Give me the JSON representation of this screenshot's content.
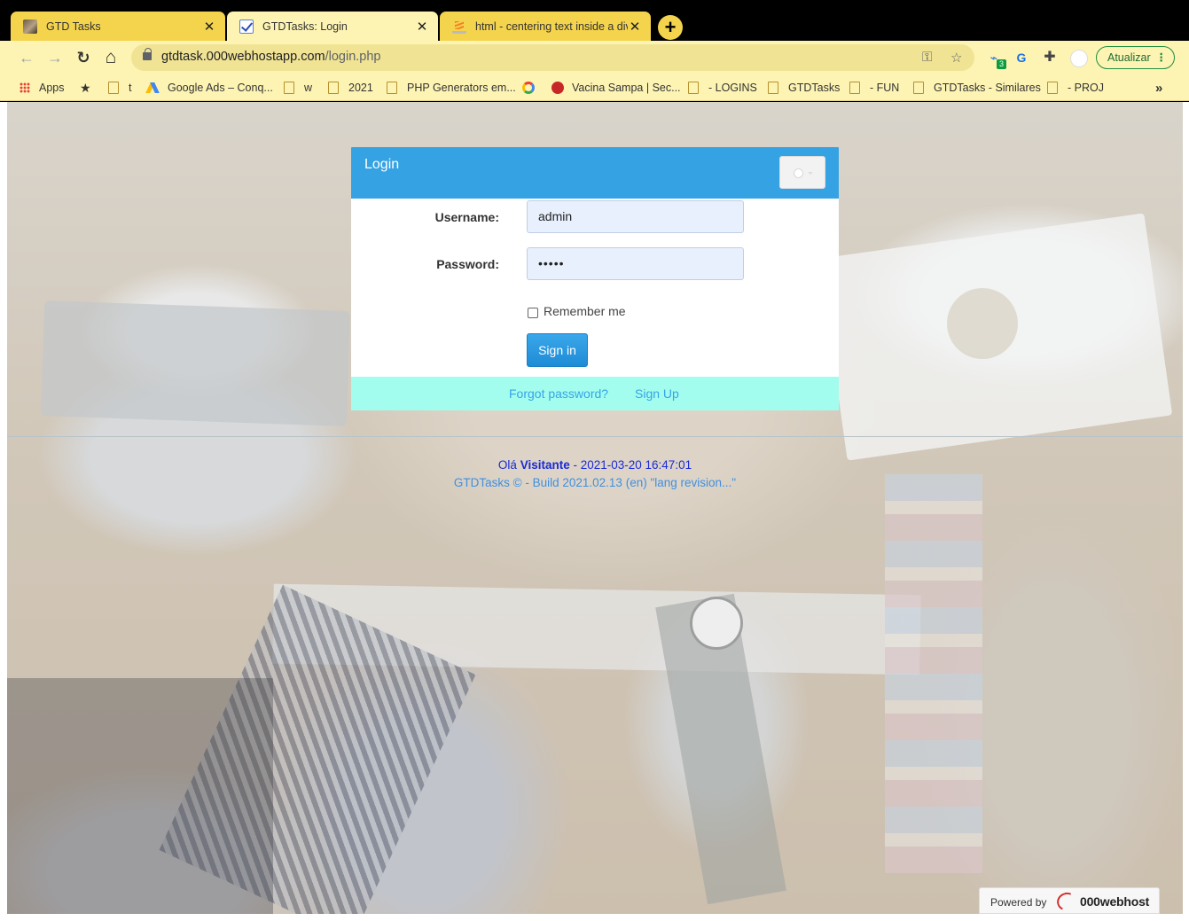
{
  "tabs": [
    {
      "title": "GTD Tasks",
      "close": "✕"
    },
    {
      "title": "GTDTasks: Login",
      "close": "✕"
    },
    {
      "title": "html - centering text inside a div",
      "close": "✕"
    }
  ],
  "new_tab": "+",
  "nav": {
    "back": "←",
    "forward": "→",
    "reload": "↻",
    "home": "⌂"
  },
  "address": {
    "host": "gtdtask.000webhostapp.com",
    "path": "/login.php"
  },
  "omni_icons": {
    "key": "⚿",
    "star": "☆"
  },
  "extensions": {
    "badge": "3",
    "update_label": "Atualizar",
    "menu": "⋮"
  },
  "bookmarks": {
    "apps": "Apps",
    "star": "★",
    "items": [
      "t",
      "Google Ads – Conq...",
      "w",
      "2021",
      "PHP Generators em...",
      "Vacina Sampa | Sec...",
      "- LOGINS",
      "GTDTasks",
      "- FUN",
      "GTDTasks - Similares",
      "- PROJ"
    ],
    "more": "»"
  },
  "login": {
    "title": "Login",
    "username_label": "Username:",
    "username_value": "admin",
    "password_label": "Password:",
    "password_value": "•••••",
    "remember_label": "Remember me",
    "signin_label": "Sign in",
    "forgot_label": "Forgot password?",
    "signup_label": "Sign Up"
  },
  "footer": {
    "greet_prefix": "Olá",
    "greet_name": "Visitante",
    "greet_datetime": "- 2021-03-20 16:47:01",
    "build": "GTDTasks © - Build 2021.02.13 (en) \"lang revision...\""
  },
  "powered": {
    "prefix": "Powered by",
    "brand": "000webhost"
  },
  "colors": {
    "tab_active": "#fdf4b3",
    "tab_inactive": "#f4d34d",
    "panel_header": "#35a2e3",
    "panel_footer": "#a2fdee",
    "primary_button": "#1e8bd6",
    "link": "#38a3e8"
  }
}
